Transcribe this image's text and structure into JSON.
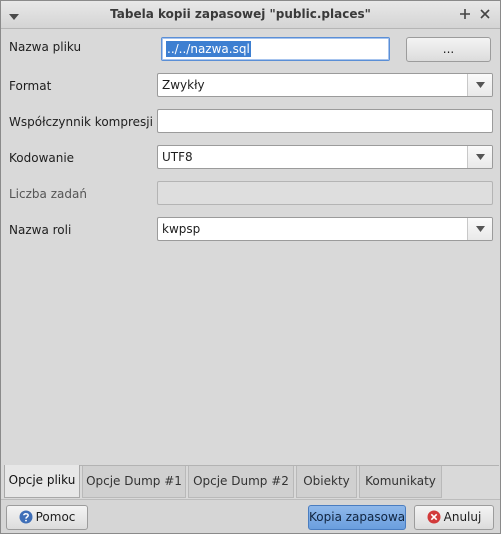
{
  "window": {
    "title": "Tabela kopii zapasowej \"public.places\""
  },
  "form": {
    "filename": {
      "label": "Nazwa pliku",
      "value": "../../nazwa.sql",
      "browse_label": "..."
    },
    "format": {
      "label": "Format",
      "value": "Zwykły"
    },
    "compression": {
      "label": "Współczynnik kompresji",
      "value": ""
    },
    "encoding": {
      "label": "Kodowanie",
      "value": "UTF8"
    },
    "jobs": {
      "label": "Liczba zadań",
      "value": ""
    },
    "role": {
      "label": "Nazwa roli",
      "value": "kwpsp"
    }
  },
  "tabs": [
    {
      "label": "Opcje pliku",
      "active": true
    },
    {
      "label": "Opcje Dump #1",
      "active": false
    },
    {
      "label": "Opcje Dump #2",
      "active": false
    },
    {
      "label": "Obiekty",
      "active": false
    },
    {
      "label": "Komunikaty",
      "active": false
    }
  ],
  "footer": {
    "help_label": "Pomoc",
    "backup_label": "Kopia zapasowa",
    "cancel_label": "Anuluj"
  },
  "colors": {
    "primary_button": "#7aa9e4",
    "selection": "#3d7fd1",
    "help_icon": "#3f6fb8",
    "cancel_icon": "#d23a3a"
  }
}
